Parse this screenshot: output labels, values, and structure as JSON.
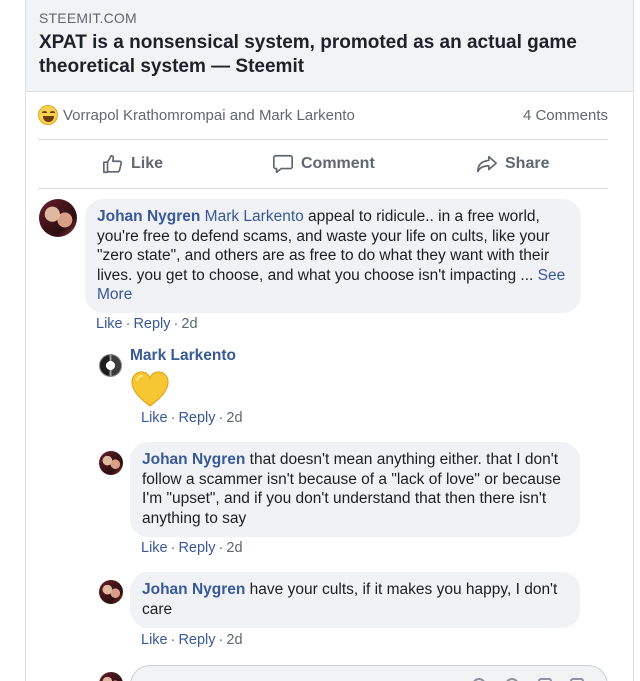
{
  "link_preview": {
    "domain": "STEEMIT.COM",
    "title": "XPAT is a nonsensical system, promoted as an actual game theoretical system — Steemit"
  },
  "reactions": {
    "reactors": "Vorrapol Krathomrompai and Mark Larkento",
    "comments_count": "4 Comments"
  },
  "actions": {
    "like": "Like",
    "comment": "Comment",
    "share": "Share"
  },
  "comments": [
    {
      "author": "Johan Nygren",
      "mention": "Mark Larkento",
      "text": " appeal to ridicule.. in a free world, you're free to defend scams, and waste your life on cults, like your \"zero state\", and others are as free to do what they want with their lives. you get to choose, and what you choose isn't impacting ... ",
      "see_more": "See More",
      "like": "Like",
      "reply": "Reply",
      "time": "2d"
    }
  ],
  "replies": [
    {
      "author": "Mark Larkento",
      "like": "Like",
      "reply": "Reply",
      "time": "2d"
    },
    {
      "author": "Johan Nygren",
      "text": " that doesn't mean anything either. that I don't follow a scammer isn't because of a \"lack of love\" or because I'm \"upset\", and if you don't understand that then there isn't anything to say",
      "like": "Like",
      "reply": "Reply",
      "time": "2d"
    },
    {
      "author": "Johan Nygren",
      "text": " have your cults, if it makes you happy, I don't care",
      "like": "Like",
      "reply": "Reply",
      "time": "2d"
    }
  ],
  "colors": {
    "link_blue": "#385898",
    "meta_gray": "#606770",
    "bubble_bg": "#f0f2f5",
    "heart_yellow": "#f7c633"
  },
  "icons": {
    "like": "thumbs-up-icon",
    "comment": "speech-bubble-icon",
    "share": "share-arrow-icon",
    "reaction": "haha-emoji-icon",
    "sticker": "yellow-heart-icon"
  }
}
